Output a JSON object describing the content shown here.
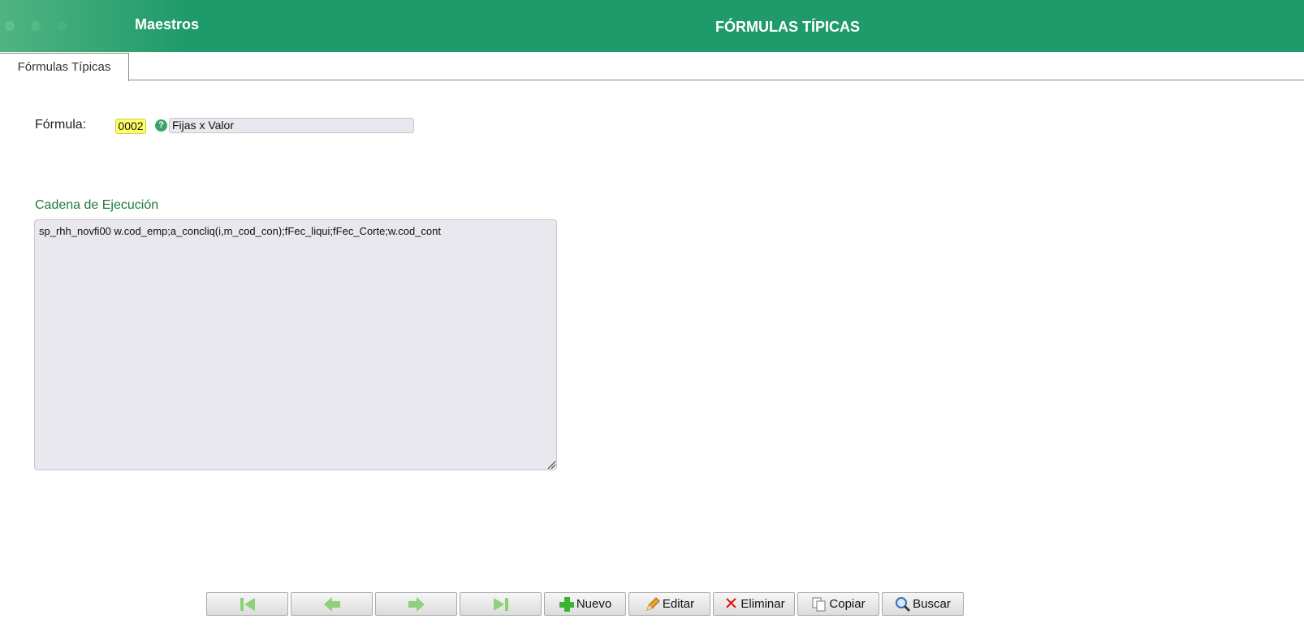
{
  "header": {
    "app_title": "Maestros",
    "page_title": "FÓRMULAS TÍPICAS"
  },
  "tabs": [
    {
      "label": "Fórmulas Típicas",
      "active": true
    }
  ],
  "form": {
    "formula_label": "Fórmula:",
    "formula_code": "0002",
    "formula_name": "Fijas x Valor",
    "section_title": "Cadena de Ejecución",
    "execution_string": "sp_rhh_novfi00 w.cod_emp;a_concliq(i,m_cod_con);fFec_liqui;fFec_Corte;w.cod_cont"
  },
  "toolbar": {
    "nav_icons": [
      "first-record-icon",
      "previous-record-icon",
      "next-record-icon",
      "last-record-icon"
    ],
    "new_label": "Nuevo",
    "edit_label": "Editar",
    "delete_label": "Eliminar",
    "copy_label": "Copiar",
    "search_label": "Buscar"
  },
  "colors": {
    "header_bg": "#1f9a6a",
    "section_title": "#1f7a3a",
    "code_highlight": "#ffff66"
  }
}
